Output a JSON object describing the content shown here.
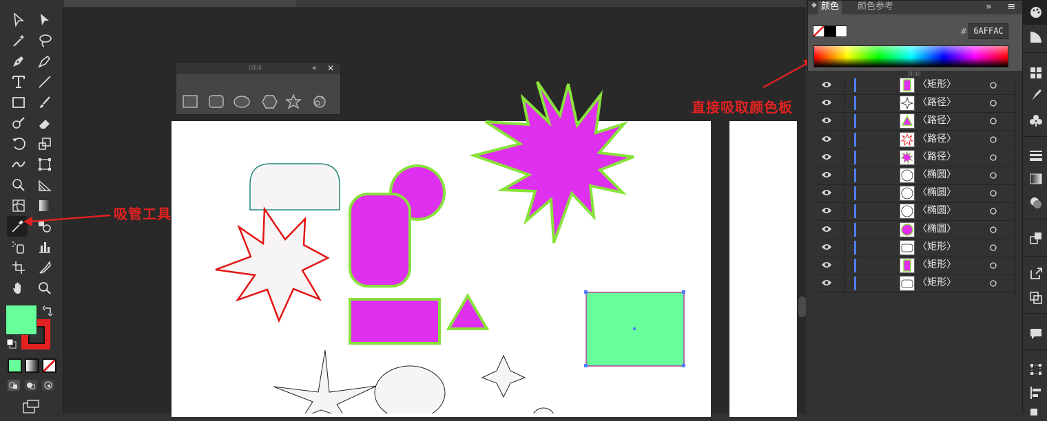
{
  "annotations": {
    "eyedropper_label": "吸管工具",
    "color_panel_label": "直接吸取颜色板"
  },
  "color_panel": {
    "tab_active": "颜色",
    "tab_inactive": "颜色参考",
    "hex_prefix": "#",
    "hex_value": "6AFFAC",
    "collapse_glyph": "»",
    "menu_glyph": "≡"
  },
  "shape_panel": {
    "collapse_glyph": "«",
    "close_glyph": "✕",
    "grip": "||||||||"
  },
  "colors": {
    "fill": "#66ff99",
    "stroke": "#e32121",
    "magenta": "#df2fef",
    "green_stroke": "#88e23b"
  },
  "layers": [
    {
      "name": "〈矩形〉",
      "thumb": "magenta-rect-icon"
    },
    {
      "name": "〈路径〉",
      "thumb": "star4-icon"
    },
    {
      "name": "〈路径〉",
      "thumb": "triangle-icon"
    },
    {
      "name": "〈路径〉",
      "thumb": "star8-icon"
    },
    {
      "name": "〈路径〉",
      "thumb": "burst-icon"
    },
    {
      "name": "〈椭圆〉",
      "thumb": "ellipse-icon"
    },
    {
      "name": "〈椭圆〉",
      "thumb": "ellipse-icon"
    },
    {
      "name": "〈椭圆〉",
      "thumb": "ellipse-icon"
    },
    {
      "name": "〈椭圆〉",
      "thumb": "magenta-circle-icon"
    },
    {
      "name": "〈矩形〉",
      "thumb": "rect-icon"
    },
    {
      "name": "〈矩形〉",
      "thumb": "magenta-rect-icon"
    },
    {
      "name": "〈矩形〉",
      "thumb": "rect-icon"
    }
  ]
}
